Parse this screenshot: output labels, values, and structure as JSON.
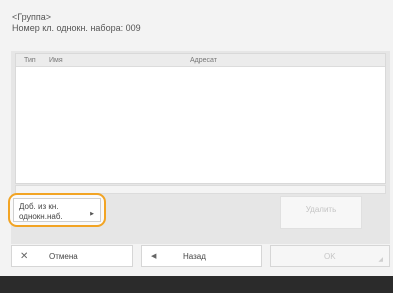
{
  "header": {
    "group_label": "<Группа>",
    "speed_dial_number": "Номер кл. однокн. набора: 009"
  },
  "list": {
    "columns": {
      "type": "Тип",
      "name": "Имя",
      "address": "Адресат"
    },
    "rows": []
  },
  "actions": {
    "add_from_speed_dial": "Доб. из кн. однокн.наб.",
    "delete": "Удалить"
  },
  "footer": {
    "cancel": "Отмена",
    "back": "Назад",
    "ok": "OK"
  },
  "icons": {
    "cancel": "close-icon",
    "back": "arrow-left-icon",
    "add": "chevron-right-icon"
  },
  "colors": {
    "highlight": "#f2a424",
    "bottom_bar": "#2b2b2b"
  }
}
